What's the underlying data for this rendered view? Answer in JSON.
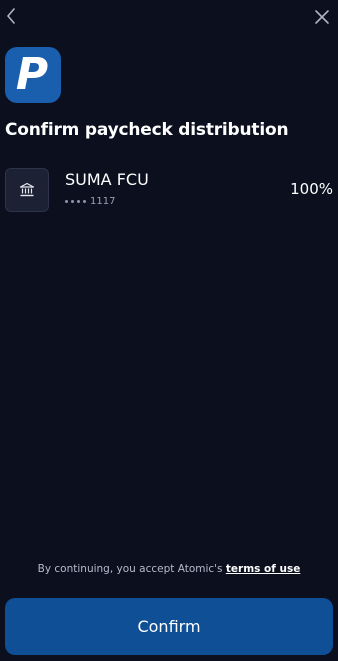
{
  "header": {
    "back_icon": "chevron-left-icon",
    "close_icon": "close-icon"
  },
  "logo": {
    "letter": "P",
    "background": "#1a5fae"
  },
  "page": {
    "title": "Confirm paycheck distribution"
  },
  "account": {
    "icon": "bank-icon",
    "name": "SUMA FCU",
    "last_four": "1117",
    "percentage": "100%"
  },
  "footer": {
    "terms_prefix": "By continuing, you accept Atomic's ",
    "terms_link": "terms of use",
    "confirm_label": "Confirm"
  },
  "colors": {
    "background": "#0b0f1e",
    "button": "#0f4f96",
    "muted_text": "#b6bbcc"
  }
}
